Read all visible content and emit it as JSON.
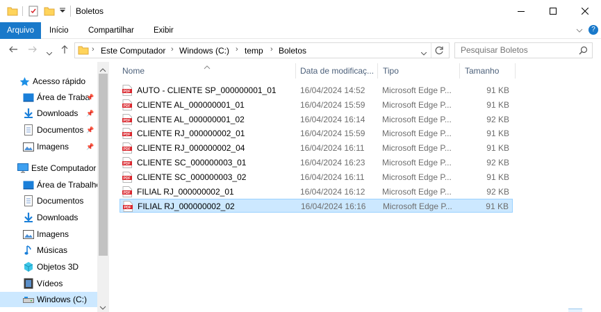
{
  "window": {
    "title": "Boletos",
    "controls": [
      "minimize",
      "maximize",
      "close"
    ]
  },
  "ribbon": {
    "tabs": [
      "Arquivo",
      "Início",
      "Compartilhar",
      "Exibir"
    ]
  },
  "address": {
    "crumbs": [
      "Este Computador",
      "Windows (C:)",
      "temp",
      "Boletos"
    ]
  },
  "search": {
    "placeholder": "Pesquisar Boletos"
  },
  "nav": {
    "items": [
      {
        "label": "Acesso rápido",
        "icon": "star-icon",
        "pinned": false,
        "indent": 1
      },
      {
        "label": "Área de Traba",
        "icon": "desktop-icon",
        "pinned": true,
        "indent": 2
      },
      {
        "label": "Downloads",
        "icon": "download-icon",
        "pinned": true,
        "indent": 2
      },
      {
        "label": "Documentos",
        "icon": "documents-icon",
        "pinned": true,
        "indent": 2
      },
      {
        "label": "Imagens",
        "icon": "pictures-icon",
        "pinned": true,
        "indent": 2
      },
      {
        "label": "Este Computador",
        "icon": "computer-icon",
        "pinned": false,
        "indent": 1
      },
      {
        "label": "Área de Trabalho",
        "icon": "desktop-icon",
        "pinned": false,
        "indent": 2
      },
      {
        "label": "Documentos",
        "icon": "documents-icon",
        "pinned": false,
        "indent": 2
      },
      {
        "label": "Downloads",
        "icon": "download-icon",
        "pinned": false,
        "indent": 2
      },
      {
        "label": "Imagens",
        "icon": "pictures-icon",
        "pinned": false,
        "indent": 2
      },
      {
        "label": "Músicas",
        "icon": "music-icon",
        "pinned": false,
        "indent": 2
      },
      {
        "label": "Objetos 3D",
        "icon": "objects3d-icon",
        "pinned": false,
        "indent": 2
      },
      {
        "label": "Vídeos",
        "icon": "videos-icon",
        "pinned": false,
        "indent": 2
      },
      {
        "label": "Windows (C:)",
        "icon": "drive-icon",
        "pinned": false,
        "indent": 2,
        "selected": true
      }
    ]
  },
  "columns": {
    "name": "Nome",
    "date": "Data de modificaç...",
    "type": "Tipo",
    "size": "Tamanho"
  },
  "files": [
    {
      "name": "AUTO - CLIENTE SP_000000001_01",
      "date": "16/04/2024 14:52",
      "type": "Microsoft Edge P...",
      "size": "91 KB"
    },
    {
      "name": "CLIENTE AL_000000001_01",
      "date": "16/04/2024 15:59",
      "type": "Microsoft Edge P...",
      "size": "91 KB"
    },
    {
      "name": "CLIENTE AL_000000001_02",
      "date": "16/04/2024 16:14",
      "type": "Microsoft Edge P...",
      "size": "92 KB"
    },
    {
      "name": "CLIENTE RJ_000000002_01",
      "date": "16/04/2024 15:59",
      "type": "Microsoft Edge P...",
      "size": "91 KB"
    },
    {
      "name": "CLIENTE RJ_000000002_04",
      "date": "16/04/2024 16:11",
      "type": "Microsoft Edge P...",
      "size": "91 KB"
    },
    {
      "name": "CLIENTE SC_000000003_01",
      "date": "16/04/2024 16:23",
      "type": "Microsoft Edge P...",
      "size": "92 KB"
    },
    {
      "name": "CLIENTE SC_000000003_02",
      "date": "16/04/2024 16:11",
      "type": "Microsoft Edge P...",
      "size": "91 KB"
    },
    {
      "name": "FILIAL RJ_000000002_01",
      "date": "16/04/2024 16:12",
      "type": "Microsoft Edge P...",
      "size": "92 KB"
    },
    {
      "name": "FILIAL RJ_000000002_02",
      "date": "16/04/2024 16:16",
      "type": "Microsoft Edge P...",
      "size": "91 KB",
      "selected": true
    }
  ],
  "colors": {
    "accent": "#1979ca",
    "selection": "#cce8ff",
    "selection_border": "#99d1ff",
    "pdf_red": "#d9232a"
  }
}
